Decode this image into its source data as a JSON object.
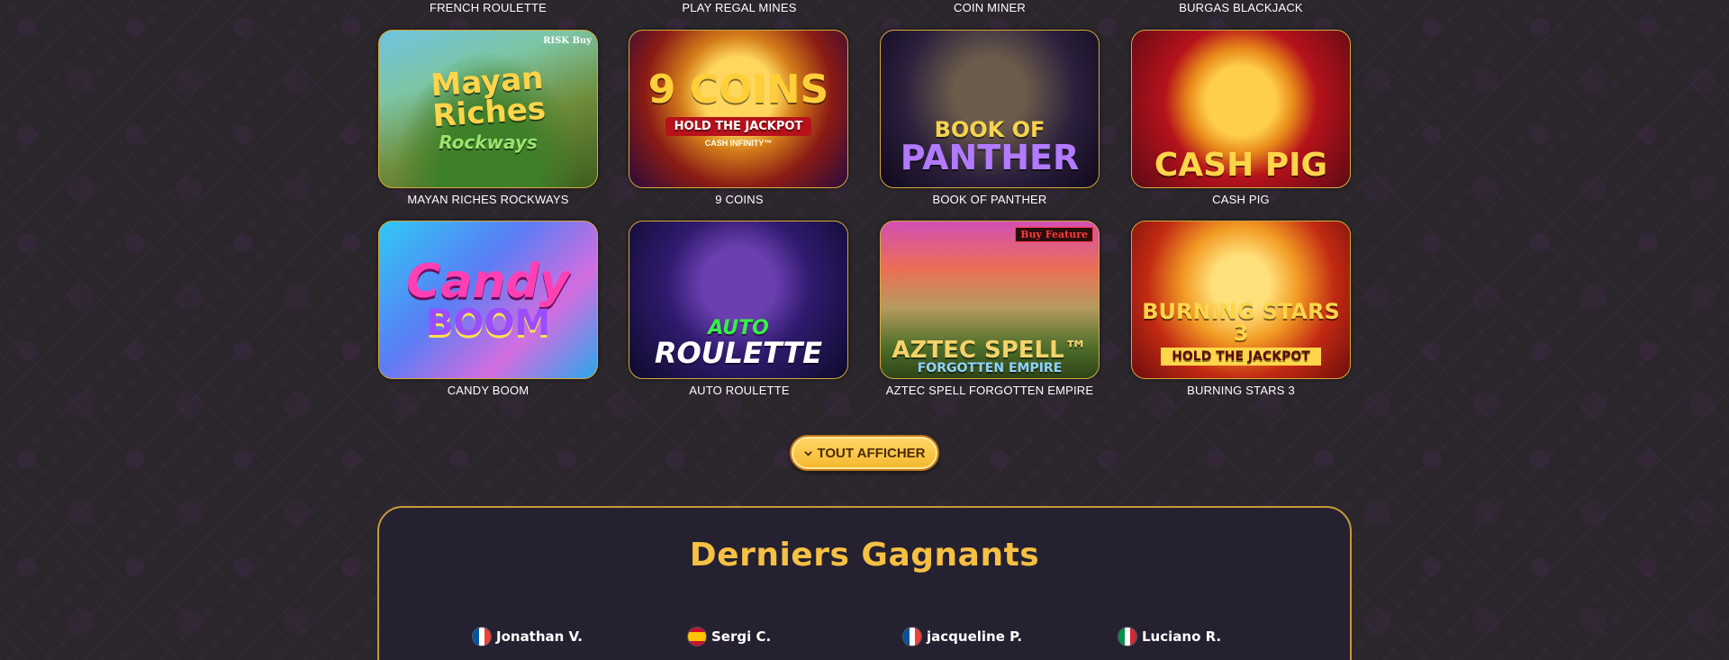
{
  "top_row_labels": [
    "FRENCH ROULETTE",
    "PLAY REGAL MINES",
    "COIN MINER",
    "BURGAS BLACKJACK"
  ],
  "games": [
    {
      "title": "MAYAN RICHES ROCKWAYS",
      "art_text": "Mayan Riches",
      "art_sub": "Rockways",
      "badge": "RISK Buy"
    },
    {
      "title": "9 COINS",
      "art_text": "9 COINS",
      "art_sub": "HOLD THE JACKPOT",
      "badge": "CASH INFINITY™"
    },
    {
      "title": "BOOK OF PANTHER",
      "art_text": "BOOK OF",
      "art_sub": "PANTHER",
      "badge": ""
    },
    {
      "title": "CASH PIG",
      "art_text": "CASH PIG",
      "art_sub": "",
      "badge": ""
    },
    {
      "title": "CANDY BOOM",
      "art_text": "Candy",
      "art_sub": "BOOM",
      "badge": ""
    },
    {
      "title": "AUTO ROULETTE",
      "art_text": "AUTO",
      "art_sub": "ROULETTE",
      "badge": ""
    },
    {
      "title": "AZTEC SPELL FORGOTTEN EMPIRE",
      "art_text": "AZTEC SPELL™",
      "art_sub": "FORGOTTEN EMPIRE",
      "badge": "Buy Feature"
    },
    {
      "title": "BURNING STARS 3",
      "art_text": "BURNING STARS 3",
      "art_sub": "HOLD THE JACKPOT",
      "badge": ""
    }
  ],
  "show_all": {
    "label": "TOUT AFFICHER",
    "icon": "chevron-down-icon"
  },
  "winners": {
    "title": "Derniers Gagnants",
    "list": [
      {
        "name": "Jonathan V.",
        "flag": "fr"
      },
      {
        "name": "Sergi C.",
        "flag": "es"
      },
      {
        "name": "jacqueline P.",
        "flag": "fr"
      },
      {
        "name": "Luciano R.",
        "flag": "it"
      }
    ]
  },
  "colors": {
    "accent": "#f6c043",
    "border": "#d6a93b",
    "background": "#2a262b"
  }
}
